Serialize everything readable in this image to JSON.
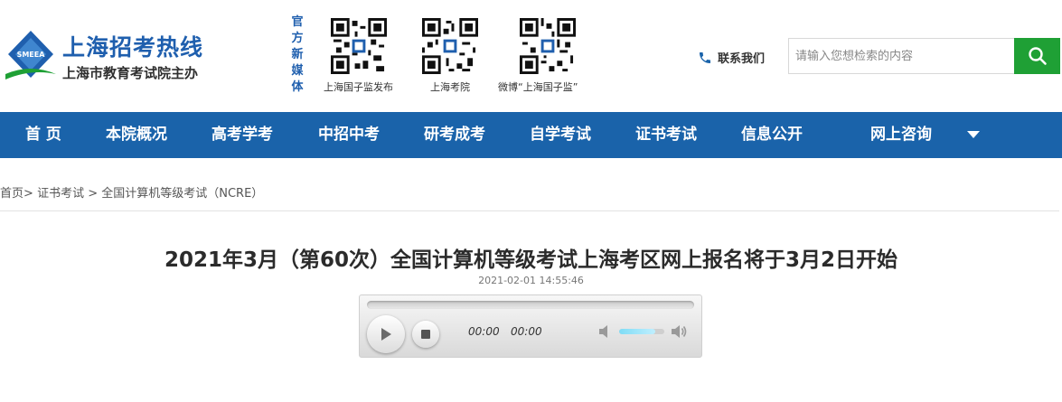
{
  "site": {
    "title": "上海招考热线",
    "subtitle": "上海市教育考试院主办",
    "logo_text": "SMEEA"
  },
  "media": {
    "label": "官方新媒体",
    "qr_codes": [
      {
        "caption": "上海国子监发布"
      },
      {
        "caption": "上海考院"
      },
      {
        "caption": "微博“上海国子监”"
      }
    ]
  },
  "contact": {
    "label": "联系我们",
    "icon": "phone-icon"
  },
  "search": {
    "placeholder": "请输入您想检索的内容",
    "button_icon": "search-icon"
  },
  "nav": {
    "items": [
      "首 页",
      "本院概况",
      "高考学考",
      "中招中考",
      "研考成考",
      "自学考试",
      "证书考试",
      "信息公开",
      "网上咨询"
    ],
    "dropdown_icon": "caret-down-icon"
  },
  "breadcrumb": {
    "home": "首页",
    "sep1": ">",
    "section": "证书考试",
    "sep2": " > ",
    "category": "全国计算机等级考试（NCRE）"
  },
  "article": {
    "title": "2021年3月（第60次）全国计算机等级考试上海考区网上报名将于3月2日开始",
    "date": "2021-02-01 14:55:46"
  },
  "player": {
    "current_time": "00:00",
    "duration": "00:00",
    "progress": 0,
    "volume": 0.8
  },
  "colors": {
    "brand_blue": "#1a63aa",
    "title_blue": "#1f5fae",
    "search_green": "#1fa035"
  }
}
